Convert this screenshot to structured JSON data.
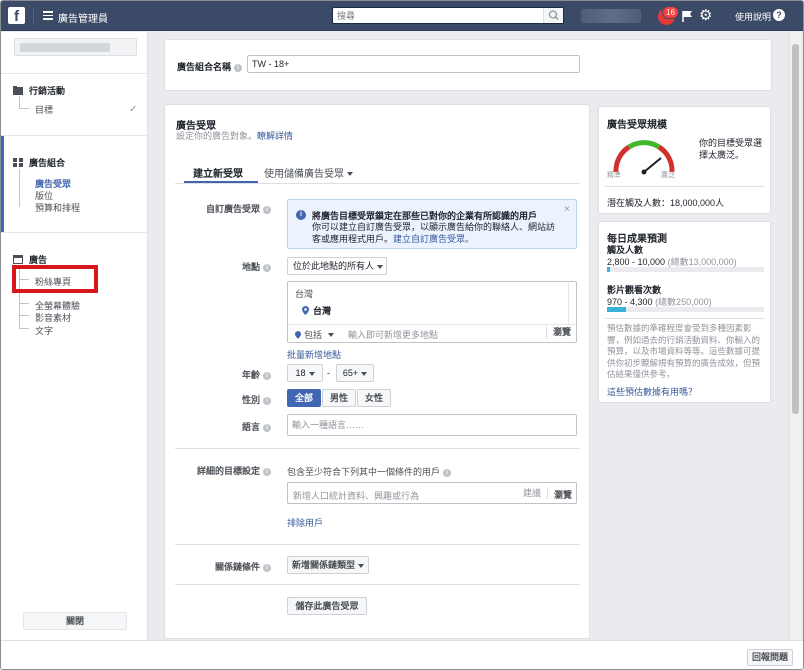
{
  "topbar": {
    "logo": "f",
    "app_title": "廣告管理員",
    "search_placeholder": "搜尋",
    "notification_count": "16",
    "help_label": "使用說明"
  },
  "sidebar": {
    "campaign": {
      "title": "行銷活動",
      "items": [
        "目標"
      ]
    },
    "adset": {
      "title": "廣告組合",
      "items": [
        "廣告受眾",
        "版位",
        "預算和排程"
      ]
    },
    "ad": {
      "title": "廣告",
      "items": [
        "粉絲專頁",
        "全螢幕體驗",
        "影音素材",
        "文字"
      ]
    },
    "close_label": "關閉"
  },
  "adset_name": {
    "label": "廣告組合名稱",
    "value": "TW - 18+"
  },
  "audience": {
    "title": "廣告受眾",
    "subtitle": "設定你的廣告對象。",
    "learn_more": "瞭解詳情",
    "tabs": [
      "建立新受眾",
      "使用儲備廣告受眾"
    ],
    "custom_audience_label": "自訂廣告受眾",
    "notice_title": "將廣告目標受眾鎖定在那些已對你的企業有所認識的用戶",
    "notice_body": "你可以建立自訂廣告受眾，以顯示廣告給你的聯絡人、網站訪客或應用程式用戶。",
    "notice_link": "建立自訂廣告受眾。",
    "location_label": "地點",
    "location_dropdown": "位於此地點的所有人",
    "location_country_group": "台灣",
    "location_selected": "台灣",
    "include_label": "包括",
    "location_placeholder": "輸入即可新增更多地點",
    "browse_label": "瀏覽",
    "bulk_location_link": "批量新增地點",
    "age_label": "年齡",
    "age_min": "18",
    "age_sep": "-",
    "age_max": "65+",
    "gender_label": "性別",
    "genders": [
      "全部",
      "男性",
      "女性"
    ],
    "language_label": "語言",
    "language_placeholder": "輸入一種語言……",
    "detailed_label": "詳細的目標設定",
    "detailed_include": "包含至少符合下列其中一個條件的用戶",
    "detailed_placeholder": "新增人口統計資料、興趣或行為",
    "suggest_label": "建議",
    "exclude_link": "排除用戶",
    "connections_label": "關係鏈條件",
    "connections_dropdown": "新增關係鏈類型",
    "save_button": "儲存此廣告受眾"
  },
  "audience_size": {
    "title": "廣告受眾規模",
    "gauge_left": "精準",
    "gauge_right": "廣泛",
    "gauge_level": 0.78,
    "description": "你的目標受眾選擇太廣泛。",
    "potential_reach": "潛在觸及人數：18,000,000人"
  },
  "daily_estimate": {
    "title": "每日成果預測",
    "reach_label": "觸及人數",
    "reach_value": "2,800 - 10,000",
    "reach_total": "(總數13,000,000)",
    "reach_fraction": 0.02,
    "impressions_label": "影片觀看次數",
    "impressions_value": "970 - 4,300",
    "impressions_total": "(總數250,000)",
    "impressions_fraction": 0.12,
    "disclaimer": "預估數據的準確程度會受到多種因素影響，例如過去的行銷活動資料、你輸入的預算，以及市場資料等等。這些數據可提供你初步瞭解規有預算的廣告成效，但預估結果僅供參考。",
    "helpful_link": "這些預估數據有用嗎？"
  },
  "footer": {
    "report_label": "回報問題"
  },
  "colors": {
    "topbar": "#3b4a66",
    "accent": "#4267b2",
    "highlight": "#d8171c"
  }
}
